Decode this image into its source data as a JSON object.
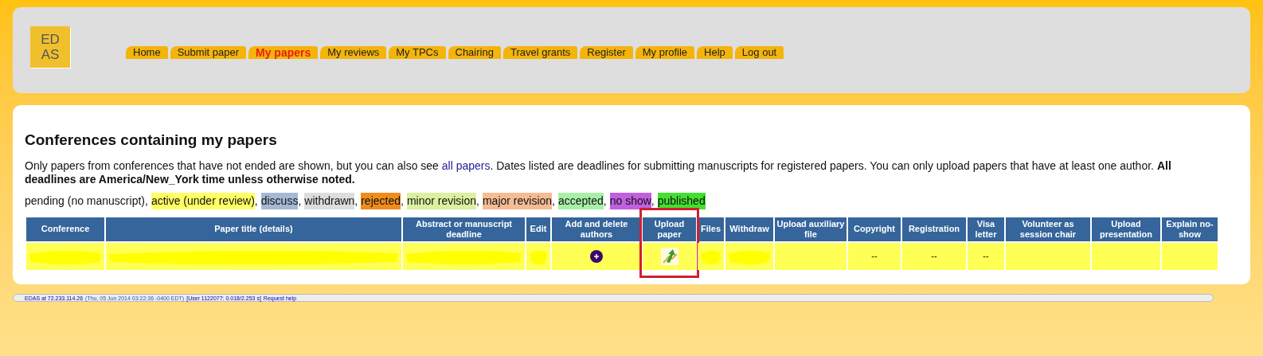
{
  "logo": {
    "line_1": "ED",
    "line_2": "AS"
  },
  "nav": [
    {
      "label": "Home",
      "selected": false
    },
    {
      "label": "Submit paper",
      "selected": false
    },
    {
      "label": "My papers",
      "selected": true
    },
    {
      "label": "My reviews",
      "selected": false
    },
    {
      "label": "My TPCs",
      "selected": false
    },
    {
      "label": "Chairing",
      "selected": false
    },
    {
      "label": "Travel grants",
      "selected": false
    },
    {
      "label": "Register",
      "selected": false
    },
    {
      "label": "My profile",
      "selected": false
    },
    {
      "label": "Help",
      "selected": false
    },
    {
      "label": "Log out",
      "selected": false
    }
  ],
  "heading": "Conferences containing my papers",
  "intro": {
    "before_link": "Only papers from conferences that have not ended are shown, but you can also see",
    "link": "all papers",
    "after_link": ". Dates listed are deadlines for submitting manuscripts for registered papers. You can only upload papers that have at least one author. **All deadlines are America/New_York time unless otherwise noted.**"
  },
  "legend": [
    {
      "label": "pending (no manuscript)"
    },
    {
      "label": "active (under review)",
      "color": "#ffff66"
    },
    {
      "label": "discuss",
      "color": "#a6b8d4"
    },
    {
      "label": "withdrawn",
      "color": "#dddddd"
    },
    {
      "label": "rejected",
      "color": "#f08c1c"
    },
    {
      "label": "minor revision",
      "color": "#dcf0a0"
    },
    {
      "label": "major revision",
      "color": "#f5bc94"
    },
    {
      "label": "accepted",
      "color": "#a8f0a8"
    },
    {
      "label": "no show",
      "color": "#c060e0"
    },
    {
      "label": "published",
      "color": "#44e030"
    }
  ],
  "legend_separator": ",",
  "table": {
    "columns": [
      "Conference",
      "Paper title (details)",
      "Abstract or manuscript deadline",
      "Edit",
      "Add and delete authors",
      "Upload paper",
      "Files",
      "Withdraw",
      "Upload auxiliary file",
      "Copyright",
      "Registration",
      "Visa letter",
      "Volunteer as session chair",
      "Upload presentation",
      "Explain no-show"
    ],
    "rows": [
      {
        "color": "#ffff55",
        "cells": [
          {
            "kind": "redacted"
          },
          {
            "kind": "redacted"
          },
          {
            "kind": "redacted"
          },
          {
            "kind": "redacted"
          },
          {
            "kind": "add-author"
          },
          {
            "kind": "upload",
            "highlighted": true
          },
          {
            "kind": "redacted"
          },
          {
            "kind": "redacted"
          },
          {
            "kind": "empty"
          },
          {
            "kind": "text",
            "text": "--"
          },
          {
            "kind": "text",
            "text": "--"
          },
          {
            "kind": "text",
            "text": "--"
          },
          {
            "kind": "empty"
          },
          {
            "kind": "empty"
          },
          {
            "kind": "empty"
          }
        ]
      }
    ]
  },
  "status_bar": {
    "host": "EDAS at 72.233.114.26",
    "time": "(Thu, 05 Jun 2014 03:22:36 -0400 EDT)",
    "user": "[User 1122077: 0.018/2.253 s]",
    "link": "Request help"
  }
}
